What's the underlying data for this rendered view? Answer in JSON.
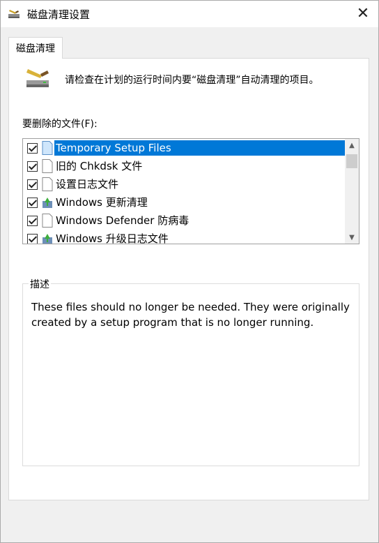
{
  "window": {
    "title": "磁盘清理设置",
    "close_label": "✕"
  },
  "tabs": [
    {
      "label": "磁盘清理"
    }
  ],
  "main": {
    "intro_text": "请检查在计划的运行时间内要“磁盘清理”自动清理的项目。",
    "files_label": "要删除的文件(F):",
    "files": [
      {
        "label": "Temporary Setup Files",
        "checked": true,
        "selected": true,
        "icon": "blank-file-icon"
      },
      {
        "label": "旧的 Chkdsk 文件",
        "checked": true,
        "selected": false,
        "icon": "blank-file-icon"
      },
      {
        "label": "设置日志文件",
        "checked": true,
        "selected": false,
        "icon": "blank-file-icon"
      },
      {
        "label": "Windows 更新清理",
        "checked": true,
        "selected": false,
        "icon": "windows-update-icon"
      },
      {
        "label": "Windows Defender 防病毒",
        "checked": true,
        "selected": false,
        "icon": "blank-file-icon"
      },
      {
        "label": "Windows 升级日志文件",
        "checked": true,
        "selected": false,
        "icon": "windows-update-icon"
      }
    ],
    "description": {
      "legend": "描述",
      "text": "These files should no longer be needed. They were originally created by a setup program that is no longer running."
    }
  },
  "colors": {
    "selection": "#0078d7",
    "window_bg": "#f0f0f0",
    "panel_bg": "#ffffff"
  }
}
